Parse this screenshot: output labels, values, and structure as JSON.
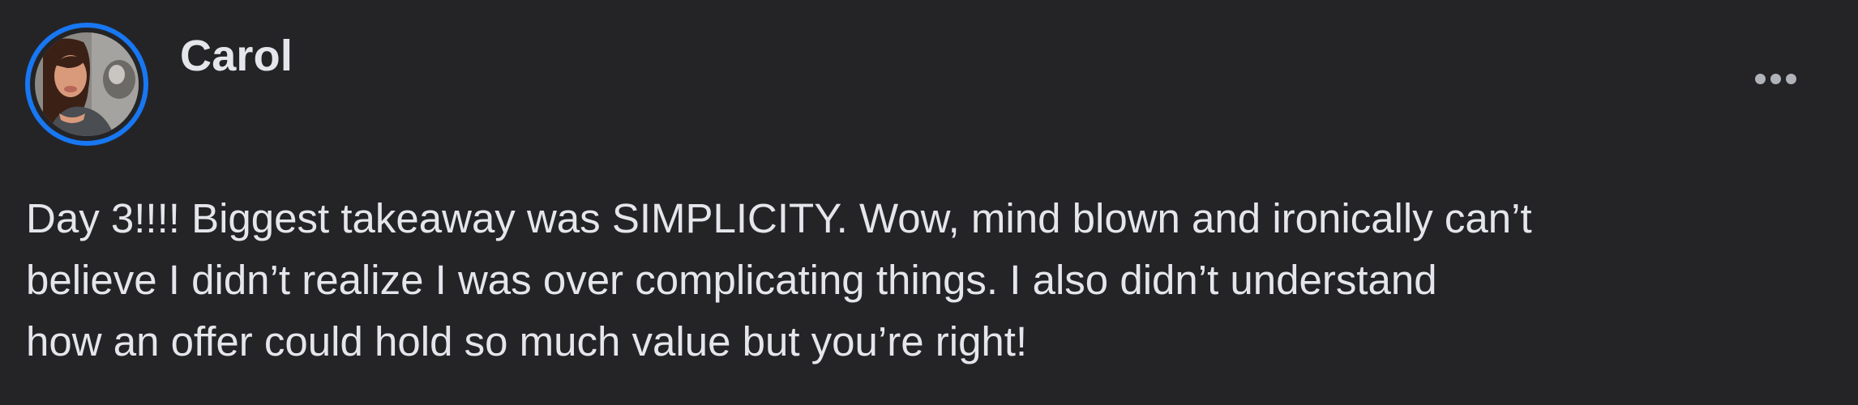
{
  "post": {
    "author": {
      "name": "Carol",
      "avatar_icon": "profile-photo-avatar",
      "ring_color": "#1877f2"
    },
    "menu_icon": "more-options-icon",
    "body_lines": [
      "Day 3!!!! Biggest takeaway was SIMPLICITY. Wow, mind blown and ironically can’t",
      "believe I didn’t realize I was over complicating things. I also didn’t understand",
      "how an offer could hold so much value but you’re right!"
    ]
  },
  "colors": {
    "background": "#242427",
    "text": "#e4e6eb",
    "icon": "#b0b3b8"
  }
}
